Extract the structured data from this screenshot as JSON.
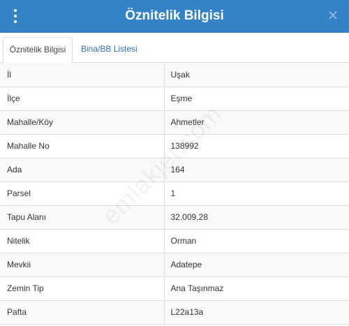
{
  "header": {
    "title": "Öznitelik Bilgisi",
    "close_symbol": "✕"
  },
  "tabs": [
    {
      "label": "Öznitelik Bilgisi",
      "active": true
    },
    {
      "label": "Bina/BB Listesi",
      "active": false
    }
  ],
  "rows": [
    {
      "label": "İl",
      "value": "Uşak"
    },
    {
      "label": "İlçe",
      "value": "Eşme"
    },
    {
      "label": "Mahalle/Köy",
      "value": "Ahmetler"
    },
    {
      "label": "Mahalle No",
      "value": "138992"
    },
    {
      "label": "Ada",
      "value": "164"
    },
    {
      "label": "Parsel",
      "value": "1"
    },
    {
      "label": "Tapu Alanı",
      "value": "32.009,28"
    },
    {
      "label": "Nitelik",
      "value": "Orman"
    },
    {
      "label": "Mevkii",
      "value": "Adatepe"
    },
    {
      "label": "Zemin Tip",
      "value": "Ana Taşınmaz"
    },
    {
      "label": "Pafta",
      "value": "L22a13a"
    }
  ],
  "watermark": "emlakjet.com",
  "colors": {
    "header": "#3483c6",
    "tab_link": "#2f6fb2"
  }
}
